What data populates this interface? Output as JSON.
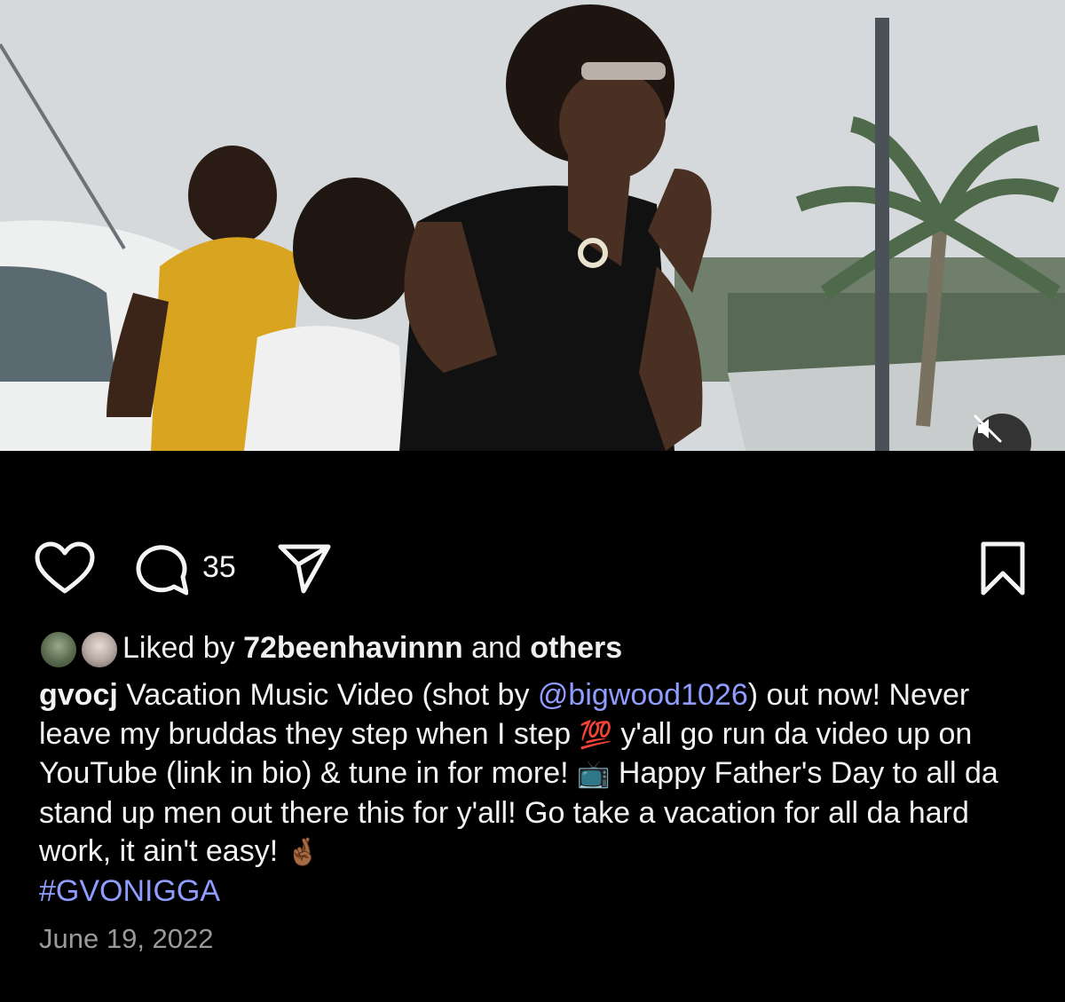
{
  "post": {
    "video": {
      "muted": true,
      "mute_icon": "speaker-muted-icon"
    },
    "actions": {
      "like_icon": "heart-outline-icon",
      "comment_icon": "comment-bubble-icon",
      "comment_count": "35",
      "share_icon": "paper-plane-icon",
      "save_icon": "bookmark-outline-icon"
    },
    "likes": {
      "prefix": "Liked by",
      "user": "72beenhavinnn",
      "conjunction": "and",
      "others": "others"
    },
    "caption": {
      "username": "gvocj",
      "text_1": "Vacation Music Video (shot by",
      "mention": "@bigwood1026",
      "text_2": ") out now! Never leave my bruddas they step when I step",
      "emoji_1": "💯",
      "text_3": "y'all go run da video up on YouTube (link in bio) & tune in for more!",
      "emoji_2": "📺",
      "text_4": "Happy Father's Day to all da stand up men out there this for y'all! Go take a vacation for all da hard work, it ain't easy!",
      "emoji_3": "🤞🏾",
      "hashtag": "#GVONIGGA"
    },
    "date": "June 19, 2022"
  },
  "colors": {
    "background": "#000000",
    "link": "#8e9dff",
    "muted_text": "#9a9a9a"
  }
}
